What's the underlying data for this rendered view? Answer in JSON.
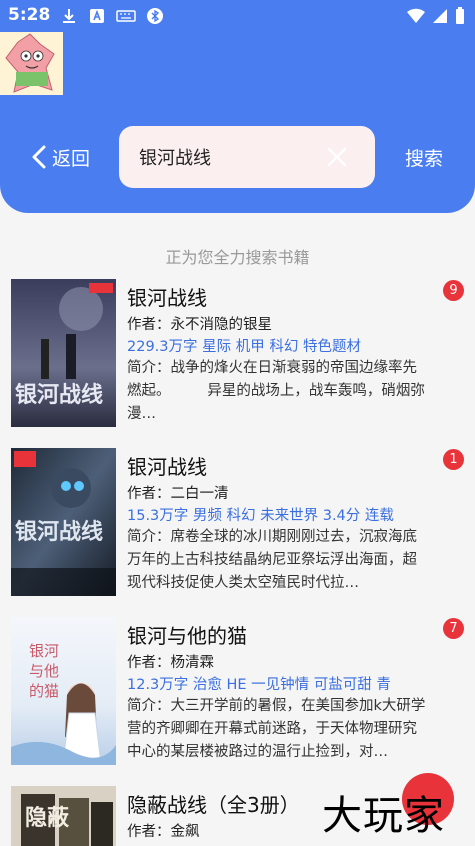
{
  "status": {
    "time": "5:28"
  },
  "header": {
    "back_label": "返回",
    "search_label": "搜索"
  },
  "search": {
    "value": "银河战线"
  },
  "hint": "正为您全力搜索书籍",
  "colors": {
    "accent": "#4a7ef0",
    "badge": "#e8333a",
    "tag": "#3b6fe0"
  },
  "books": [
    {
      "title": "银河战线",
      "author": "作者：永不消隐的银星",
      "tags": "229.3万字  星际  机甲  科幻  特色题材",
      "intro": "简介：战争的烽火在日渐衰弱的帝国边缘率先燃起。        异星的战场上，战车轰鸣，硝烟弥漫…",
      "badge": "9",
      "cover_text": "银河战线"
    },
    {
      "title": "银河战线",
      "author": "作者：二白一清",
      "tags": "15.3万字  男频  科幻  未来世界  3.4分  连载",
      "intro": "简介：席卷全球的冰川期刚刚过去，沉寂海底万年的上古科技结晶纳尼亚祭坛浮出海面，超现代科技促使人类太空殖民时代拉…",
      "badge": "1",
      "cover_text": "银河战线"
    },
    {
      "title": "银河与他的猫",
      "author": "作者：杨清霖",
      "tags": "12.3万字  治愈  HE  一见钟情  可盐可甜  青",
      "intro": "简介：大三开学前的暑假，在美国参加k大研学营的齐卿卿在开幕式前迷路，于天体物理研究中心的某层楼被路过的温行止捡到，对…",
      "badge": "7",
      "cover_text": "银河与他的猫"
    },
    {
      "title": "隐蔽战线（全3册）",
      "author": "作者：金飙",
      "tags": "",
      "intro": "",
      "badge": "",
      "cover_text": "隐蔽"
    }
  ],
  "watermark": "大玩家"
}
